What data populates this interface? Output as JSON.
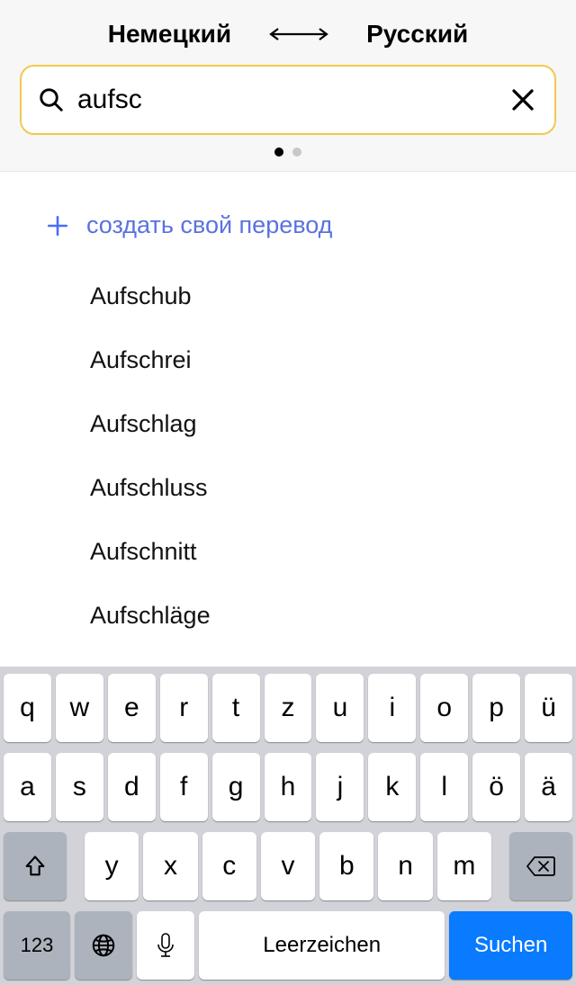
{
  "header": {
    "source_lang": "Немецкий",
    "target_lang": "Русский"
  },
  "search": {
    "value": "aufsc",
    "placeholder": ""
  },
  "create_row": {
    "label": "создать свой перевод"
  },
  "suggestions": [
    "Aufschub",
    "Aufschrei",
    "Aufschlag",
    "Aufschluss",
    "Aufschnitt",
    "Aufschläge"
  ],
  "keyboard": {
    "row1": [
      "q",
      "w",
      "e",
      "r",
      "t",
      "z",
      "u",
      "i",
      "o",
      "p",
      "ü"
    ],
    "row2": [
      "a",
      "s",
      "d",
      "f",
      "g",
      "h",
      "j",
      "k",
      "l",
      "ö",
      "ä"
    ],
    "row3": [
      "y",
      "x",
      "c",
      "v",
      "b",
      "n",
      "m"
    ],
    "numeric_label": "123",
    "space_label": "Leerzeichen",
    "search_label": "Suchen"
  }
}
